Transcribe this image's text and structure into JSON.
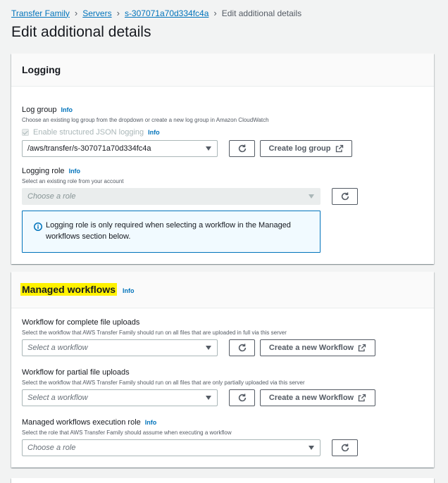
{
  "breadcrumb": {
    "items": [
      "Transfer Family",
      "Servers",
      "s-307071a70d334fc4a"
    ],
    "current": "Edit additional details"
  },
  "page": {
    "title": "Edit additional details"
  },
  "logging": {
    "title": "Logging",
    "log_group": {
      "label": "Log group",
      "info": "Info",
      "description": "Choose an existing log group from the dropdown or create a new log group in Amazon CloudWatch",
      "structured_label": "Enable structured JSON logging",
      "structured_info": "Info",
      "value": "/aws/transfer/s-307071a70d334fc4a",
      "create_button": "Create log group"
    },
    "role": {
      "label": "Logging role",
      "info": "Info",
      "description": "Select an existing role from your account",
      "placeholder": "Choose a role"
    },
    "alert": {
      "line1": "Logging role is only required when selecting a workflow in the Managed",
      "line2": "workflows section below."
    }
  },
  "workflows": {
    "title": "Managed workflows",
    "info": "Info",
    "complete": {
      "label": "Workflow for complete file uploads",
      "description": "Select the workflow that AWS Transfer Family should run on all files that are uploaded in full via this server",
      "placeholder": "Select a workflow",
      "create_button": "Create a new Workflow"
    },
    "partial": {
      "label": "Workflow for partial file uploads",
      "description": "Select the workflow that AWS Transfer Family should run on all files that are only partially uploaded via this server",
      "placeholder": "Select a workflow",
      "create_button": "Create a new Workflow"
    },
    "execution_role": {
      "label": "Managed workflows execution role",
      "info": "Info",
      "description": "Select the role that AWS Transfer Family should assume when executing a workflow",
      "placeholder": "Choose a role"
    }
  },
  "colors": {
    "link": "#0073bb",
    "highlight": "#fff200",
    "alert_border": "#0073bb",
    "alert_bg": "#f1faff"
  }
}
